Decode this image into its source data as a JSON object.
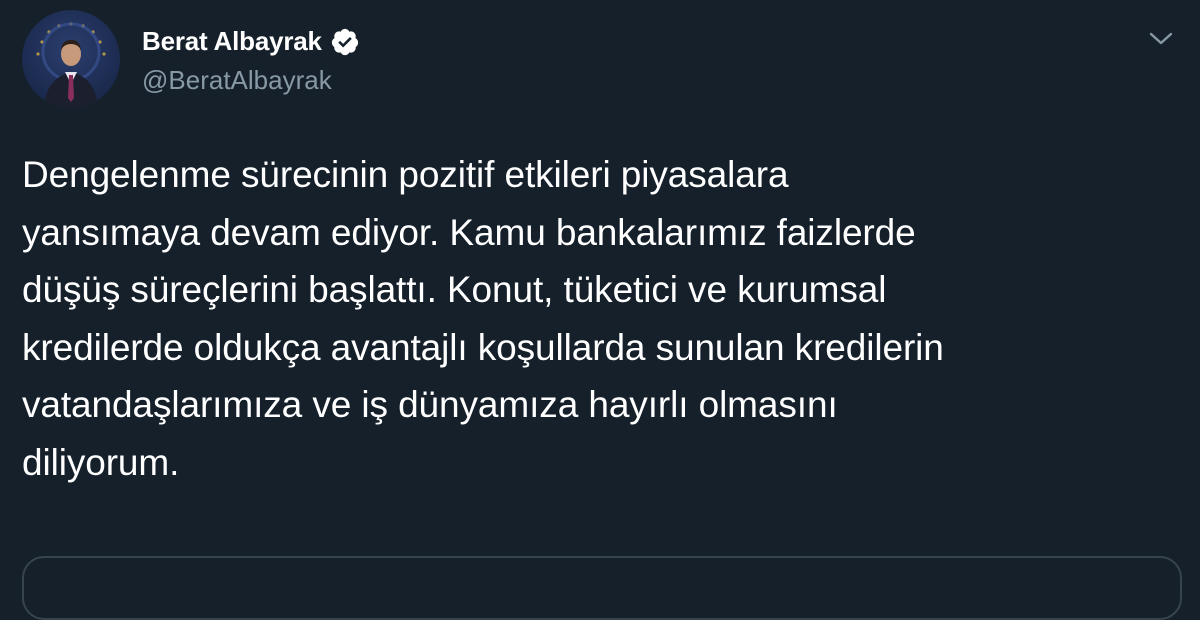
{
  "tweet": {
    "author": {
      "display_name": "Berat Albayrak",
      "handle": "@BeratAlbayrak",
      "verified": true
    },
    "text": "Dengelenme sürecinin pozitif etkileri piyasalara\nyansımaya devam ediyor. Kamu bankalarımız faizlerde\ndüşüş süreçlerini başlattı. Konut, tüketici ve kurumsal\nkredilerde oldukça avantajlı koşullarda sunulan kredilerin\nvatandaşlarımıza ve iş dünyamıza hayırlı olmasını\ndiliyorum."
  },
  "icons": {
    "verified": "verified-badge-icon",
    "more": "chevron-down-icon"
  },
  "colors": {
    "background": "#15202b",
    "text": "#ffffff",
    "secondary_text": "#8899a6",
    "border": "#38444d"
  }
}
